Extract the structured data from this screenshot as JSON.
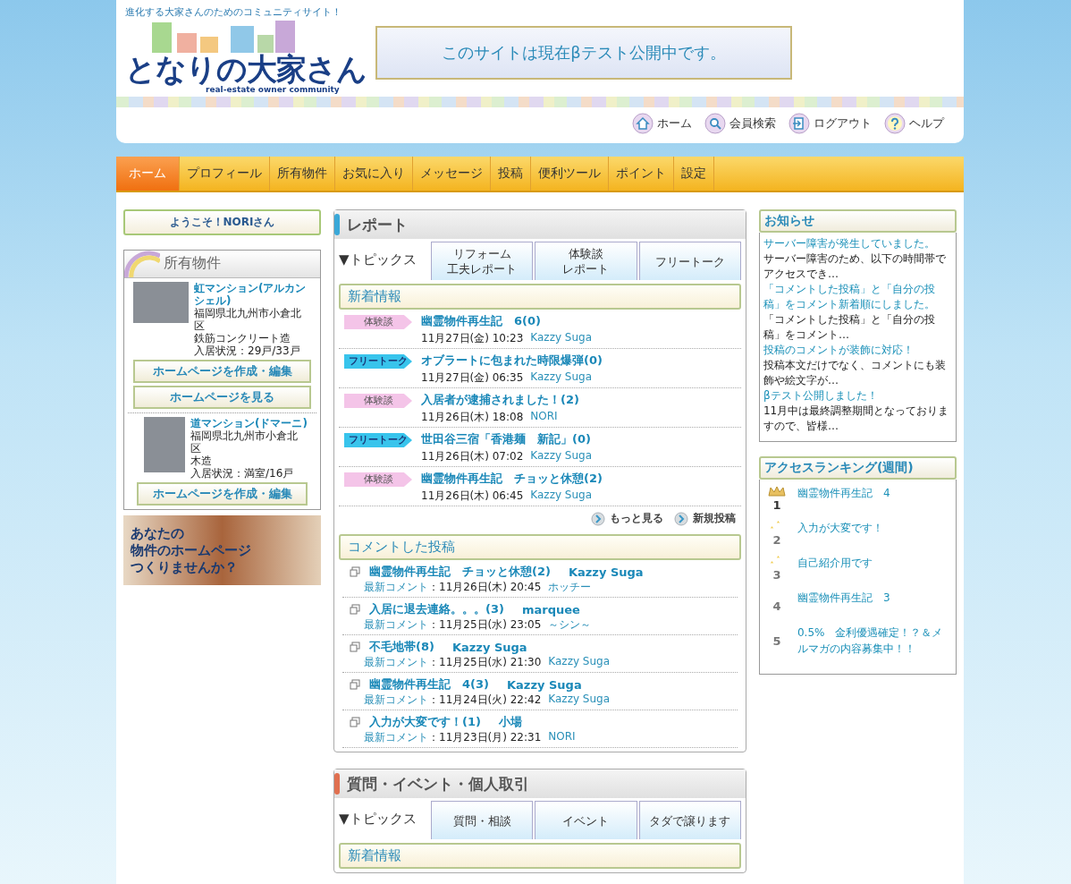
{
  "tagline": "進化する大家さんのためのコミュニティサイト！",
  "logo": {
    "title": "となりの大家さん",
    "subtitle": "real-estate owner community"
  },
  "notice_banner": "このサイトは現在βテスト公開中です。",
  "utility_links": [
    {
      "kind": "home",
      "label": "ホーム"
    },
    {
      "kind": "search",
      "label": "会員検索"
    },
    {
      "kind": "logout",
      "label": "ログアウト"
    },
    {
      "kind": "help",
      "label": "ヘルプ"
    }
  ],
  "nav": [
    {
      "label": "ホーム",
      "selected": true
    },
    {
      "label": "プロフィール",
      "selected": false
    },
    {
      "label": "所有物件",
      "selected": false
    },
    {
      "label": "お気に入り",
      "selected": false
    },
    {
      "label": "メッセージ",
      "selected": false
    },
    {
      "label": "投稿",
      "selected": false
    },
    {
      "label": "便利ツール",
      "selected": false
    },
    {
      "label": "ポイント",
      "selected": false
    },
    {
      "label": "設定",
      "selected": false
    }
  ],
  "welcome": "ようこそ！NORIさん",
  "properties": {
    "title": "所有物件",
    "items": [
      {
        "name": "虹マンション(アルカンシェル)",
        "address": "福岡県北九州市小倉北区",
        "structure": "鉄筋コンクリート造",
        "occupancy": "入居状況：29戸/33戸",
        "buttons": [
          "ホームページを作成・編集",
          "ホームページを見る"
        ]
      },
      {
        "name": "道マンション(ドマーニ)",
        "address": "福岡県北九州市小倉北区",
        "structure": "木造",
        "occupancy": "入居状況：満室/16戸",
        "buttons": [
          "ホームページを作成・編集"
        ]
      }
    ]
  },
  "promo_banner": [
    "あなたの",
    "物件のホームページ",
    "つくりませんか？"
  ],
  "report": {
    "title": "レポート",
    "topics_label": "▼トピックス",
    "tabs": [
      [
        "リフォーム",
        "工夫レポート"
      ],
      [
        "体験談",
        "レポート"
      ],
      [
        "フリートーク"
      ]
    ],
    "new_posts": {
      "title": "新着情報",
      "items": [
        {
          "tag": {
            "kind": "experience",
            "label": "体験談"
          },
          "title": "幽霊物件再生記　6(0)",
          "date": "11月27日(金) 10:23",
          "author": "Kazzy Suga"
        },
        {
          "tag": {
            "kind": "freetalk",
            "label": "フリートーク"
          },
          "title": "オブラートに包まれた時限爆弾(0)",
          "date": "11月27日(金) 06:35",
          "author": "Kazzy Suga"
        },
        {
          "tag": {
            "kind": "experience",
            "label": "体験談"
          },
          "title": "入居者が逮捕されました！(2)",
          "date": "11月26日(木) 18:08",
          "author": "NORI"
        },
        {
          "tag": {
            "kind": "freetalk",
            "label": "フリートーク"
          },
          "title": "世田谷三宿「香港麺　新記」(0)",
          "date": "11月26日(木) 07:02",
          "author": "Kazzy Suga"
        },
        {
          "tag": {
            "kind": "experience",
            "label": "体験談"
          },
          "title": "幽霊物件再生記　チョッと休憩(2)",
          "date": "11月26日(木) 06:45",
          "author": "Kazzy Suga"
        }
      ]
    },
    "more_links": [
      "もっと見る",
      "新規投稿"
    ]
  },
  "commented": {
    "title": "コメントした投稿",
    "items": [
      {
        "title": "幽霊物件再生記　チョッと休憩(2)",
        "author": "Kazzy Suga",
        "comment_label": "最新コメント",
        "date": "：11月26日(木) 20:45",
        "commenter": "ホッチー"
      },
      {
        "title": "入居に退去連絡。。。(3)",
        "author": "marquee",
        "comment_label": "最新コメント",
        "date": "：11月25日(水) 23:05",
        "commenter": "～シン～"
      },
      {
        "title": "不毛地帯(8)",
        "author": "Kazzy Suga",
        "comment_label": "最新コメント",
        "date": "：11月25日(水) 21:30",
        "commenter": "Kazzy Suga"
      },
      {
        "title": "幽霊物件再生記　4(3)",
        "author": "Kazzy Suga",
        "comment_label": "最新コメント",
        "date": "：11月24日(火) 22:42",
        "commenter": "Kazzy Suga"
      },
      {
        "title": "入力が大変です！(1)",
        "author": "小場",
        "comment_label": "最新コメント",
        "date": "：11月23日(月) 22:31",
        "commenter": "NORI"
      }
    ]
  },
  "qa": {
    "title": "質問・イベント・個人取引",
    "topics_label": "▼トピックス",
    "tabs": [
      [
        "質問・相談"
      ],
      [
        "イベント"
      ],
      [
        "タダで譲ります"
      ]
    ],
    "new_posts": {
      "title": "新着情報"
    }
  },
  "news": {
    "title": "お知らせ",
    "items": [
      {
        "headline": "サーバー障害が発生していました。",
        "summary": "サーバー障害のため、以下の時間帯でアクセスでき…"
      },
      {
        "headline": "「コメントした投稿」と「自分の投稿」をコメント新着順にしました。",
        "summary": "「コメントした投稿」と「自分の投稿」をコメント…"
      },
      {
        "headline": "投稿のコメントが装飾に対応！",
        "summary": "投稿本文だけでなく、コメントにも装飾や絵文字が…"
      },
      {
        "headline": "βテスト公開しました！",
        "summary": "11月中は最終調整期間となっておりますので、皆様…"
      }
    ]
  },
  "ranking": {
    "title": "アクセスランキング(週間)",
    "items": [
      {
        "kind": "crown",
        "rank": "1",
        "title": "幽霊物件再生記　4"
      },
      {
        "kind": "stars",
        "rank": "2",
        "title": "入力が大変です！"
      },
      {
        "kind": "stars",
        "rank": "3",
        "title": "自己紹介用です"
      },
      {
        "kind": "plain",
        "rank": "4",
        "title": "幽霊物件再生記　3"
      },
      {
        "kind": "plain",
        "rank": "5",
        "title": "0.5%　金利優遇確定！？＆メルマガの内容募集中！！"
      }
    ]
  }
}
